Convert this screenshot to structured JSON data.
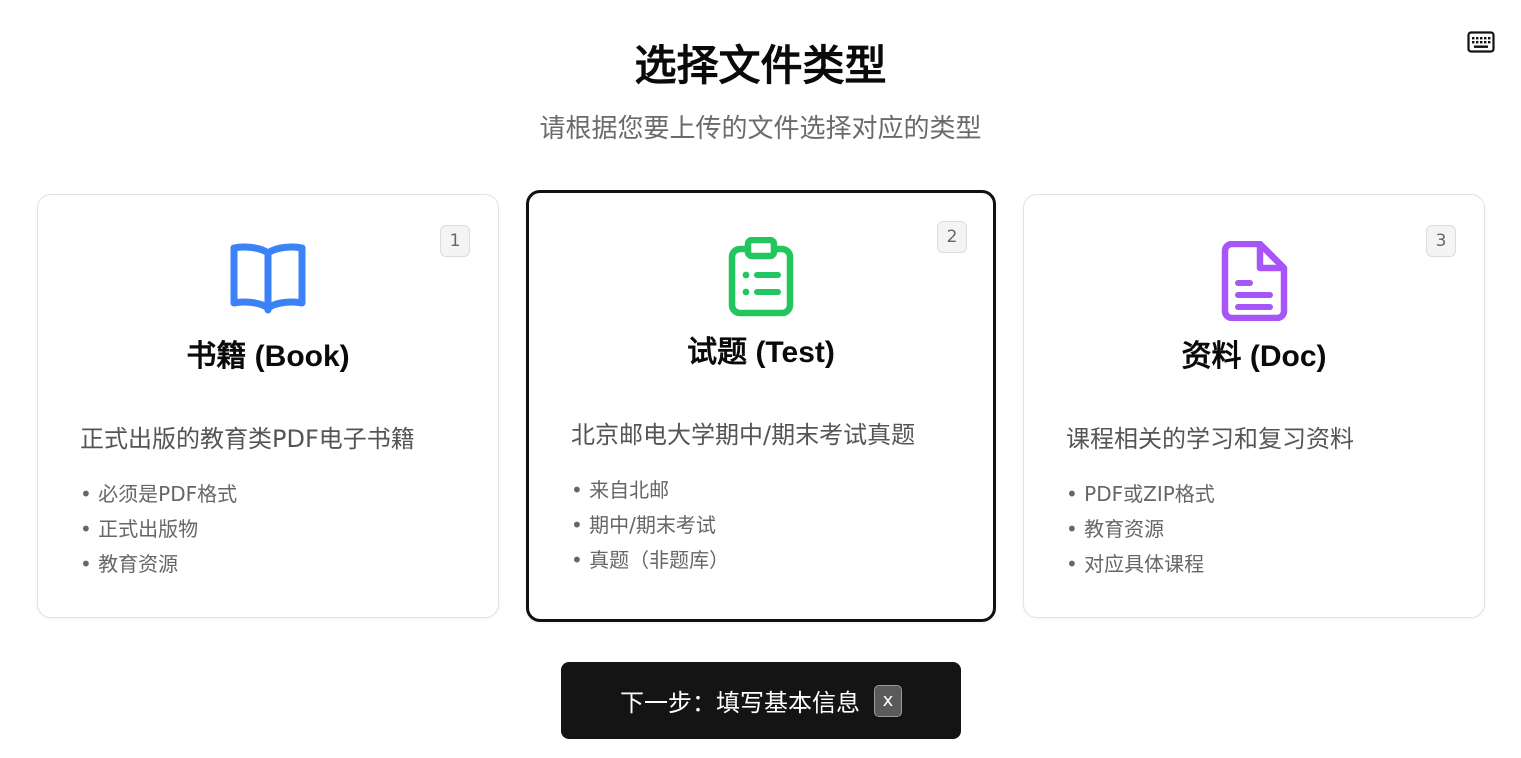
{
  "header": {
    "title": "选择文件类型",
    "subtitle": "请根据您要上传的文件选择对应的类型",
    "keyboard_icon": "keyboard-icon"
  },
  "cards": [
    {
      "number": "1",
      "icon": "book-open-icon",
      "icon_color": "#3b82f6",
      "title": "书籍 (Book)",
      "description": "正式出版的教育类PDF电子书籍",
      "features": [
        "必须是PDF格式",
        "正式出版物",
        "教育资源"
      ],
      "selected": false
    },
    {
      "number": "2",
      "icon": "clipboard-list-icon",
      "icon_color": "#22c55e",
      "title": "试题 (Test)",
      "description": "北京邮电大学期中/期末考试真题",
      "features": [
        "来自北邮",
        "期中/期末考试",
        "真题（非题库）"
      ],
      "selected": true
    },
    {
      "number": "3",
      "icon": "file-text-icon",
      "icon_color": "#a855f7",
      "title": "资料 (Doc)",
      "description": "课程相关的学习和复习资料",
      "features": [
        "PDF或ZIP格式",
        "教育资源",
        "对应具体课程"
      ],
      "selected": false
    }
  ],
  "next_button": {
    "label": "下一步：填写基本信息",
    "shortcut": "x"
  }
}
